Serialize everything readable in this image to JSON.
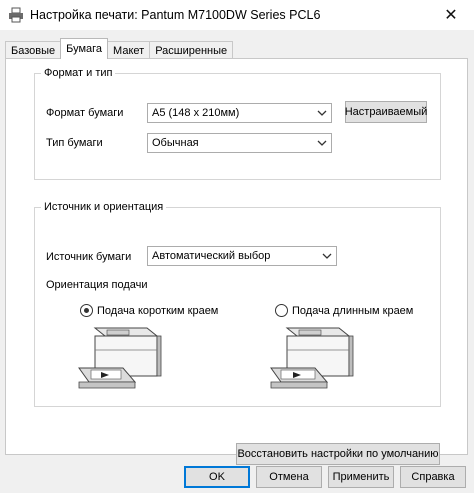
{
  "window": {
    "title": "Настройка печати: Pantum M7100DW Series PCL6",
    "close_symbol": "✕",
    "app_icon": "printer-icon"
  },
  "tabs": [
    {
      "label": "Базовые",
      "active": false
    },
    {
      "label": "Бумага",
      "active": true
    },
    {
      "label": "Макет",
      "active": false
    },
    {
      "label": "Расширенные",
      "active": false
    }
  ],
  "format_group": {
    "label": "Формат и тип",
    "paper_size_label": "Формат бумаги",
    "paper_size_value": "A5 (148 x 210мм)",
    "custom_button": "Настраиваемый",
    "paper_type_label": "Тип бумаги",
    "paper_type_value": "Обычная"
  },
  "source_group": {
    "label": "Источник и ориентация",
    "source_label": "Источник бумаги",
    "source_value": "Автоматический выбор",
    "feed_label": "Ориентация подачи",
    "short_edge_label": "Подача коротким краем",
    "short_edge_checked": true,
    "long_edge_label": "Подача длинным краем",
    "long_edge_checked": false
  },
  "restore_defaults_button": "Восстановить настройки по умолчанию",
  "footer": {
    "ok": "OK",
    "cancel": "Отмена",
    "apply": "Применить",
    "help": "Справка"
  },
  "colors": {
    "accent": "#0078d7",
    "dialog_bg": "#f0f0f0",
    "button_bg": "#e1e1e1"
  }
}
